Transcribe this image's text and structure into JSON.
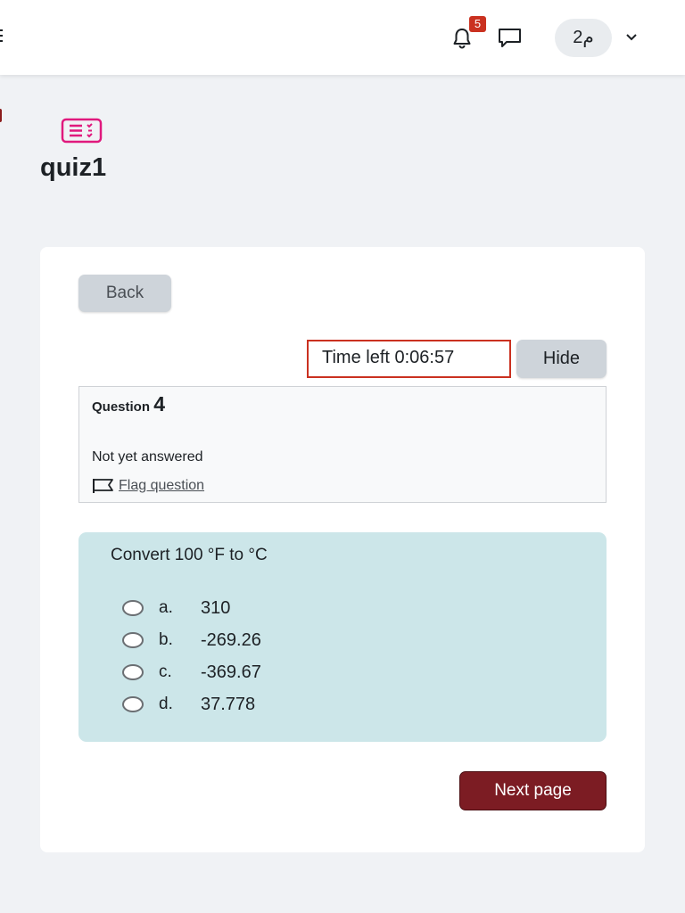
{
  "header": {
    "notification_count": "5",
    "user_initials": "م2",
    "icons": {
      "menu": "hamburger-icon",
      "notifications": "bell-icon",
      "messages": "chat-bubble-icon",
      "user_menu": "chevron-down-icon"
    }
  },
  "page": {
    "icon": "quiz-icon",
    "title": "quiz1"
  },
  "quiz": {
    "back_label": "Back",
    "timer_text": "Time left 0:06:57",
    "hide_label": "Hide",
    "question": {
      "label": "Question",
      "number": "4",
      "state": "Not yet answered",
      "flag_label": "Flag question",
      "text": "Convert 100 °F to °C",
      "options": [
        {
          "letter": "a.",
          "text": "310"
        },
        {
          "letter": "b.",
          "text": "-269.26"
        },
        {
          "letter": "c.",
          "text": "-369.67"
        },
        {
          "letter": "d.",
          "text": "37.778"
        }
      ]
    },
    "next_label": "Next page"
  },
  "colors": {
    "accent": "#7c1c23",
    "badge": "#ca3120",
    "timer_border": "#ca3120",
    "question_background": "#cce6e9",
    "quiz_icon": "#e0197d"
  }
}
